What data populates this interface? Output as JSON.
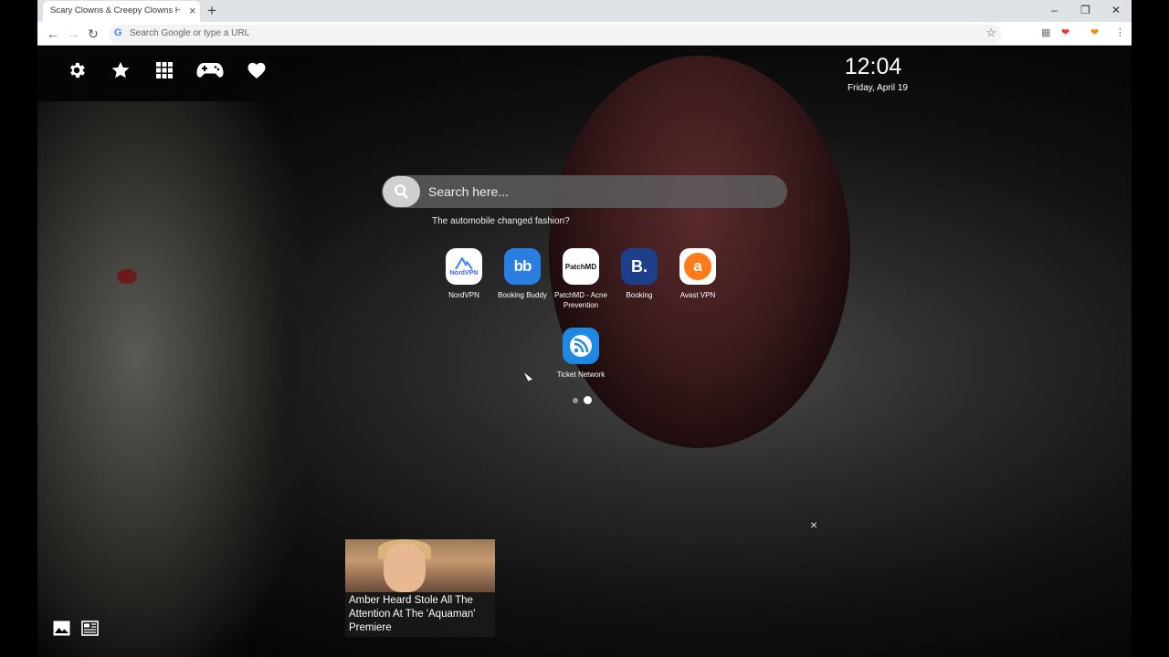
{
  "browser": {
    "tab_title": "Scary Clowns & Creepy Clowns HD W",
    "tab_close": "×",
    "new_tab": "+",
    "window_controls": {
      "minimize": "–",
      "restore": "❐",
      "close": "✕"
    },
    "nav": {
      "back": "←",
      "forward": "→",
      "reload": "↻"
    },
    "omnibox_placeholder": "Search Google or type a URL",
    "google_glyph": "G",
    "bookmark_star": "☆",
    "extension_glyphs": [
      "▦",
      "❤",
      "❤",
      "⋮"
    ]
  },
  "top_icons": [
    "gear-icon",
    "star-icon",
    "apps-grid-icon",
    "gamepad-icon",
    "heart-icon"
  ],
  "clock": {
    "time": "12:04",
    "date": "Friday, April 19"
  },
  "search": {
    "placeholder": "Search here...",
    "trending": "The automobile changed fashion?"
  },
  "tiles": [
    {
      "label": "NordVPN",
      "icon": "nordvpn-icon",
      "icon_text": "NordVPN",
      "color": "#ffffff"
    },
    {
      "label": "Booking Buddy",
      "icon": "booking-buddy-icon",
      "icon_text": "bb",
      "color": "#2a7de1"
    },
    {
      "label": "PatchMD - Acne Prevention",
      "icon": "patchmd-icon",
      "icon_text": "PatchMD",
      "color": "#ffffff"
    },
    {
      "label": "Booking",
      "icon": "booking-icon",
      "icon_text": "B.",
      "color": "#1d3f8a"
    },
    {
      "label": "Avast VPN",
      "icon": "avast-icon",
      "icon_text": "a",
      "color": "#ff7a1a"
    },
    {
      "label": "Ticket Network",
      "icon": "rss-icon",
      "icon_text": "",
      "color": "#1e88e5"
    }
  ],
  "pagination": {
    "pages": 2,
    "active": 2
  },
  "news": {
    "close": "×",
    "headline": "Amber Heard Stole All The Attention At The 'Aquaman' Premiere"
  },
  "bottom_icons": [
    "image-icon",
    "news-icon"
  ]
}
